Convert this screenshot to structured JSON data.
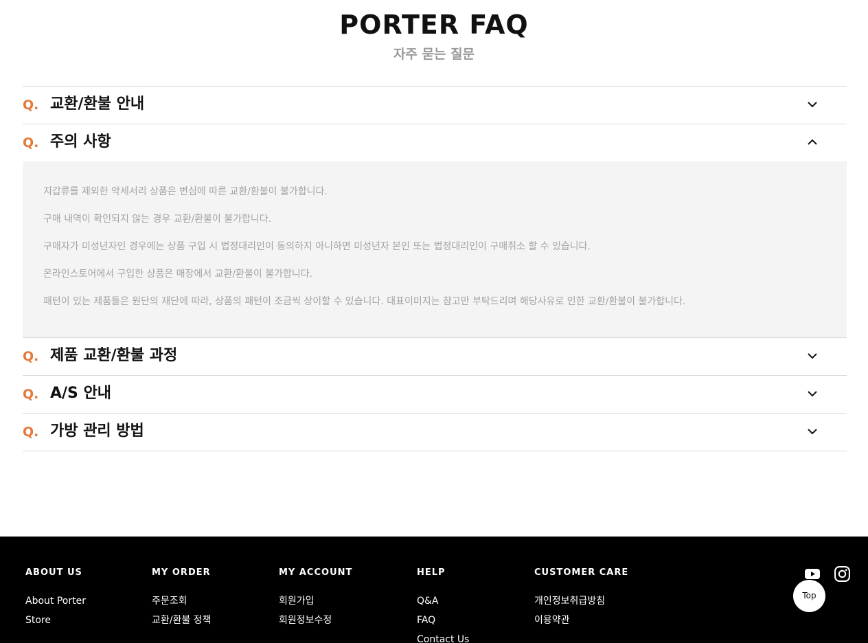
{
  "header": {
    "title": "PORTER FAQ",
    "subtitle": "자주 묻는 질문"
  },
  "faq": {
    "q_label": "Q.",
    "items": [
      {
        "title": "교환/환불 안내",
        "expanded": false
      },
      {
        "title": "주의 사항",
        "expanded": true,
        "lines": [
          "지갑류를 제외한 악세서리 상품은 변심에 따른 교환/환불이 불가합니다.",
          "구매 내역이 확인되지 않는 경우 교환/환불이 불가합니다.",
          "구매자가 미성년자인 경우에는 상품 구입 시 법정대리인이 동의하지 아니하면 미성년자 본인 또는 법정대리인이 구매취소 할 수 있습니다.",
          "온라인스토어에서 구입한 상품은 매장에서 교환/환불이 불가합니다.",
          "패턴이 있는 제품들은 원단의 재단에 따라, 상품의 패턴이 조금씩 상이할 수 있습니다. 대표이미지는 참고만 부탁드리며 해당사유로 인한 교환/환불이 불가합니다."
        ]
      },
      {
        "title": "제품 교환/환불 과정",
        "expanded": false
      },
      {
        "title": "A/S 안내",
        "expanded": false
      },
      {
        "title": "가방 관리 방법",
        "expanded": false
      }
    ],
    "icons": {
      "collapsed": "chevron-down-icon",
      "expanded": "chevron-up-icon"
    }
  },
  "footer": {
    "about": {
      "heading": "ABOUT US",
      "links": [
        "About Porter",
        "Store"
      ]
    },
    "order": {
      "heading": "MY ORDER",
      "links": [
        "주문조회",
        "교환/환불 정책"
      ]
    },
    "account": {
      "heading": "MY ACCOUNT",
      "links": [
        "회원가입",
        "회원정보수정"
      ]
    },
    "help": {
      "heading": "HELP",
      "links": [
        "Q&A",
        "FAQ",
        "Contact Us"
      ]
    },
    "care": {
      "heading": "CUSTOMER CARE",
      "links": [
        "개인정보취급방침",
        "이용약관"
      ]
    },
    "social": [
      "youtube-icon",
      "instagram-icon"
    ]
  },
  "top_button": {
    "label": "Top"
  },
  "colors": {
    "accent": "#e4793a",
    "footer_bg": "#000000",
    "answer_bg": "#f4f4f4"
  }
}
